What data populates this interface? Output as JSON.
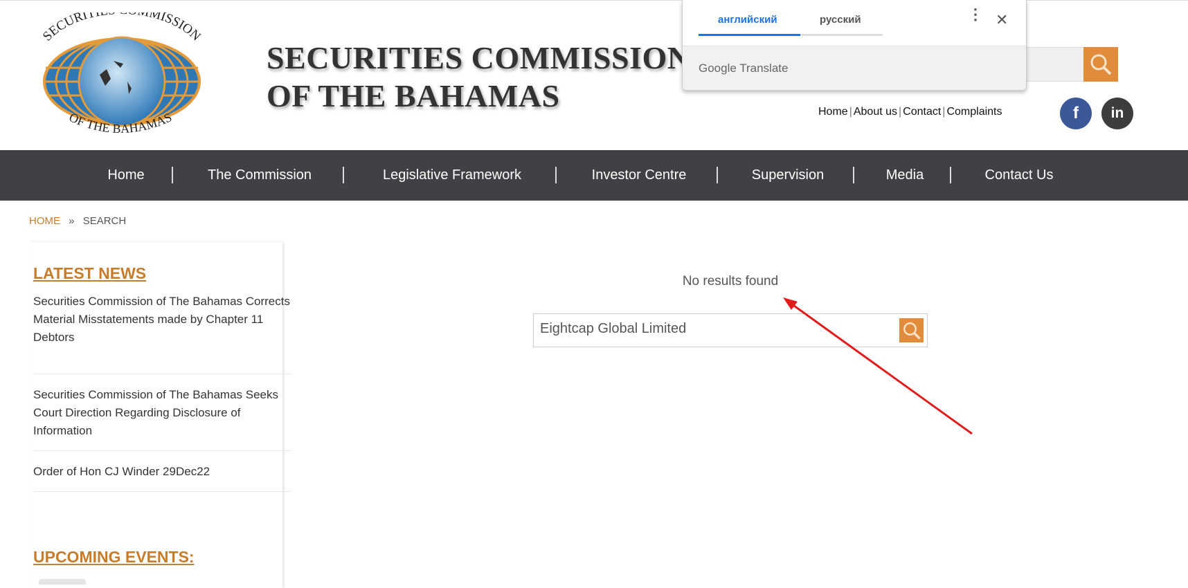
{
  "logo": {
    "text_top": "SECURITIES COMMISSION",
    "text_bottom": "OF THE BAHAMAS"
  },
  "header": {
    "title_line1": "SECURITIES COMMISSION",
    "title_line2": "OF THE BAHAMAS",
    "search_icon": "magnifier-icon"
  },
  "toplinks": [
    "Home",
    "About us",
    "Contact",
    "Complaints"
  ],
  "social": {
    "facebook": "f",
    "linkedin": "in",
    "facebook_color": "#3b5998",
    "linkedin_color": "#3d3d3d"
  },
  "translate_popup": {
    "tabs": [
      "английский",
      "русский"
    ],
    "active_tab": 0,
    "footer": "Google Translate",
    "menu_icon": "more-vert-icon",
    "close_icon": "close-icon"
  },
  "nav": [
    "Home",
    "The Commission",
    "Legislative Framework",
    "Investor Centre",
    "Supervision",
    "Media",
    "Contact Us"
  ],
  "breadcrumb": {
    "home": "HOME",
    "sep": "»",
    "current": "SEARCH"
  },
  "sidebar": {
    "latest_news_title": "LATEST NEWS",
    "news": [
      "Securities Commission of The Bahamas Corrects Material Misstatements made by Chapter 11 Debtors",
      "Securities Commission of The Bahamas Seeks Court Direction Regarding Disclosure of Information",
      "Order of Hon CJ Winder 29Dec22"
    ],
    "upcoming_title": "UPCOMING EVENTS:"
  },
  "main": {
    "no_results": "No results found",
    "search_value": "Eightcap Global Limited"
  },
  "colors": {
    "accent": "#e08c3a",
    "heading": "#c77c2c",
    "nav_bg": "#414145",
    "translate_blue": "#1a73e8",
    "annotation_arrow": "#e01b1b"
  }
}
